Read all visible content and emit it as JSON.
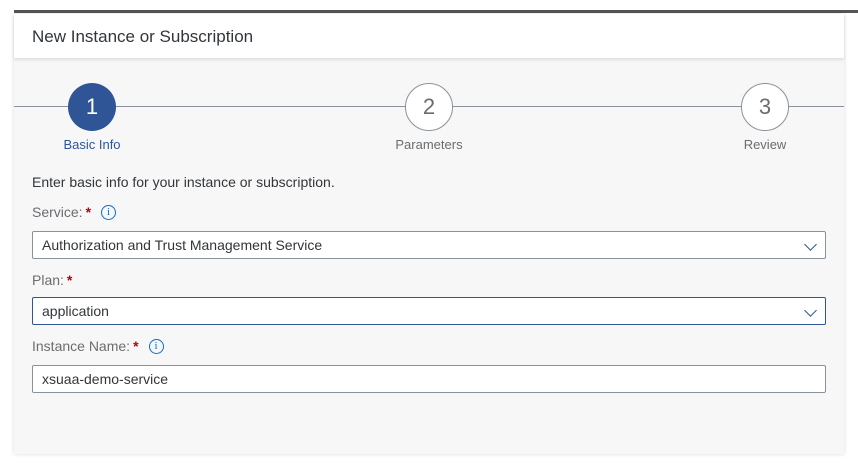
{
  "dialog": {
    "title": "New Instance or Subscription"
  },
  "stepper": {
    "steps": [
      {
        "number": "1",
        "label": "Basic Info",
        "state": "active"
      },
      {
        "number": "2",
        "label": "Parameters",
        "state": "inactive"
      },
      {
        "number": "3",
        "label": "Review",
        "state": "inactive"
      }
    ]
  },
  "form": {
    "intro": "Enter basic info for your instance or subscription.",
    "service": {
      "label": "Service:",
      "required": "*",
      "value": "Authorization and Trust Management Service"
    },
    "plan": {
      "label": "Plan:",
      "required": "*",
      "value": "application"
    },
    "instance_name": {
      "label": "Instance Name:",
      "required": "*",
      "value": "xsuaa-demo-service"
    }
  },
  "colors": {
    "accent": "#2f5597",
    "required": "#bb0000",
    "info": "#0a6ed1"
  }
}
